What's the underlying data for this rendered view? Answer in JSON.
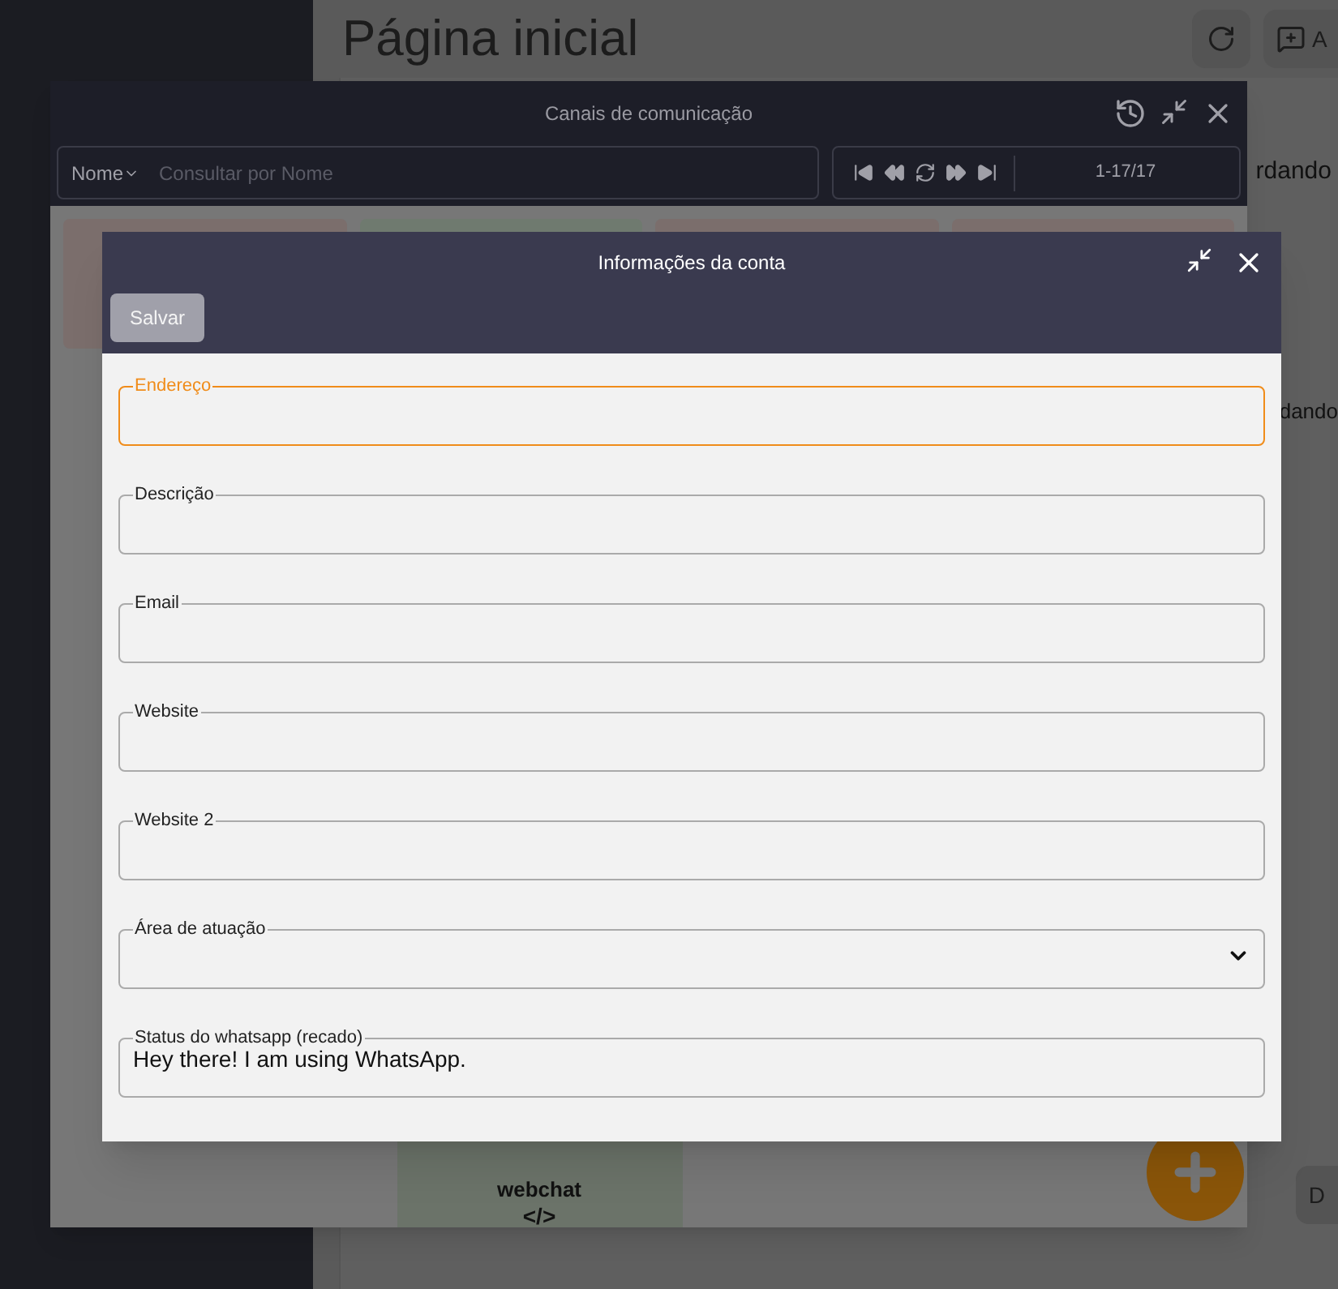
{
  "page": {
    "title": "Página inicial",
    "cut_button_text": "A",
    "side_texts": [
      {
        "text": "rdando"
      },
      {
        "text": "dando"
      },
      {
        "text": "D"
      }
    ]
  },
  "channels_window": {
    "title": "Canais de comunicação",
    "filter": "Nome",
    "search_placeholder": "Consultar por Nome",
    "range": "1-17/17",
    "cards": [
      {
        "color": "#7b6e6c"
      },
      {
        "color": "#6f7a6f"
      },
      {
        "color": "#7b6e6c"
      },
      {
        "color": "#7b6e6c"
      }
    ],
    "webchat": "webchat",
    "webchat_symbol": "</>"
  },
  "account_dialog": {
    "title": "Informações da conta",
    "save": "Salvar",
    "fields": [
      {
        "kind": "text",
        "label": "Endereço",
        "focused": true
      },
      {
        "kind": "text",
        "label": "Descrição",
        "focused": false
      },
      {
        "kind": "text",
        "label": "Email",
        "focused": false
      },
      {
        "kind": "text",
        "label": "Website",
        "focused": false
      },
      {
        "kind": "text",
        "label": "Website 2",
        "focused": false
      },
      {
        "kind": "select",
        "label": "Área de atuação",
        "focused": false
      },
      {
        "kind": "text",
        "label": "Status do whatsapp (recado)",
        "value": "Hey there! I am using WhatsApp.",
        "focused": false
      }
    ]
  }
}
